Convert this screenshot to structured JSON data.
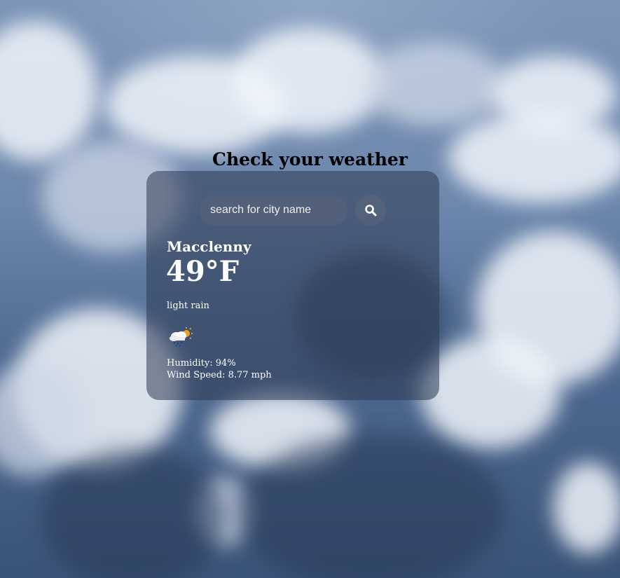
{
  "page": {
    "title": "Check your weather"
  },
  "search": {
    "placeholder": "search for city name",
    "button_icon": "search-icon"
  },
  "weather": {
    "city": "Macclenny",
    "temperature": "49°F",
    "description": "light rain",
    "icon": "rain-cloud-sun-icon",
    "humidity": "Humidity: 94%",
    "wind_speed": "Wind Speed: 8.77 mph"
  },
  "colors": {
    "card_background": "#2d3a52",
    "text": "#ffffff",
    "title": "#000000"
  }
}
